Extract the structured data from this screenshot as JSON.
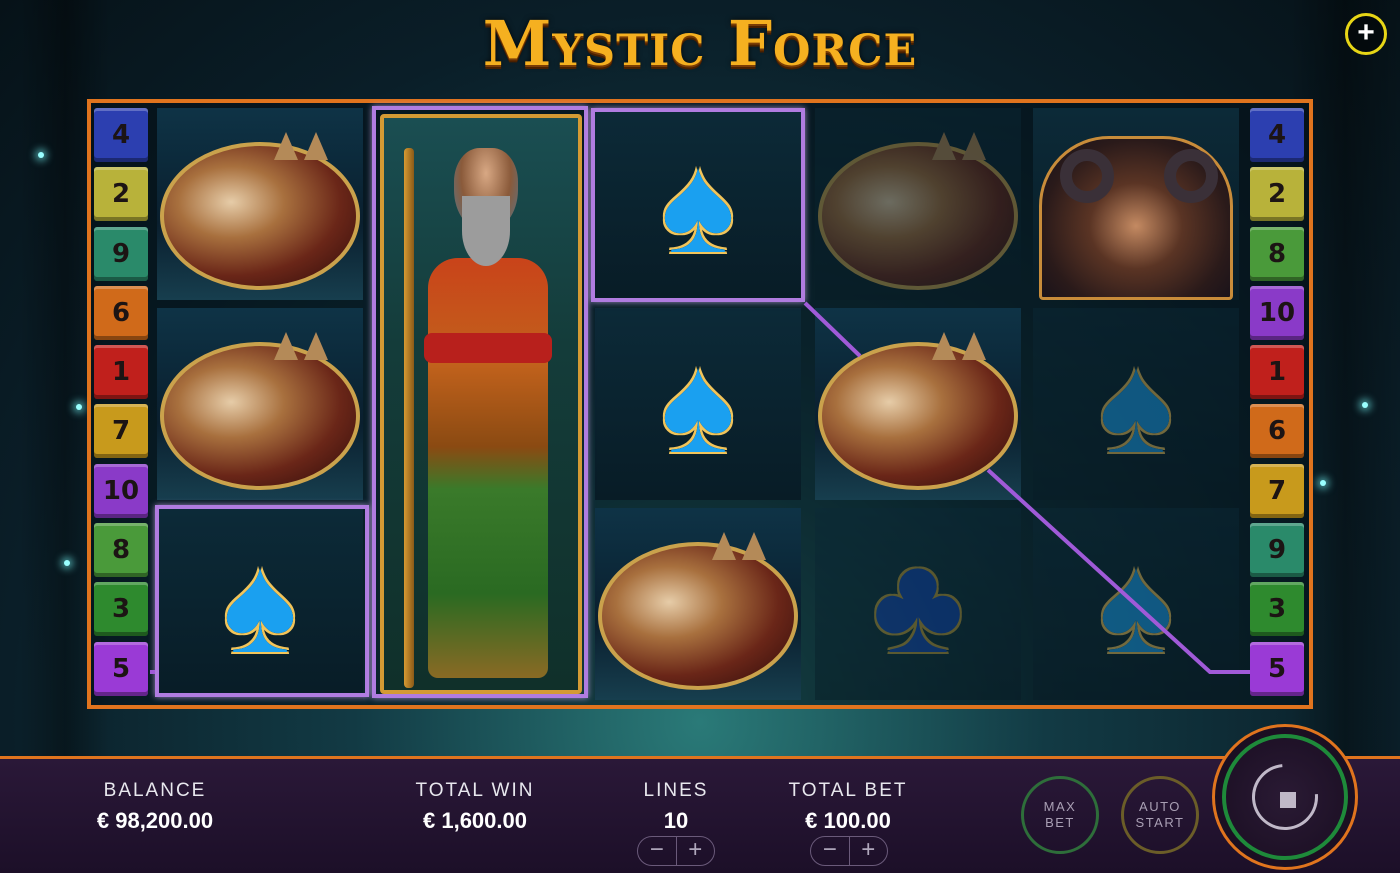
{
  "game": {
    "title": "Mystic Force"
  },
  "top": {
    "plus_symbol": "+"
  },
  "paylines": {
    "left": [
      "4",
      "2",
      "9",
      "6",
      "1",
      "7",
      "10",
      "8",
      "3",
      "5"
    ],
    "right": [
      "4",
      "2",
      "8",
      "10",
      "1",
      "6",
      "7",
      "9",
      "3",
      "5"
    ],
    "colors": {
      "1": "#c0201c",
      "2": "#b8b23a",
      "3": "#2e8a2e",
      "4": "#2c3fb0",
      "5": "#9a3ad6",
      "6": "#d06a1a",
      "7": "#c89a1c",
      "8": "#4a9a3a",
      "9": "#2a8a6a",
      "10": "#8a3ac8"
    }
  },
  "reels": [
    [
      "lynx",
      "lynx",
      "spade"
    ],
    [
      "wizard",
      "wizard",
      "wizard"
    ],
    [
      "spade",
      "spade",
      "lynx"
    ],
    [
      "lynx",
      "lynx",
      "club"
    ],
    [
      "beast",
      "spade",
      "spade"
    ]
  ],
  "symbols": {
    "spade": "♠",
    "club": "♣"
  },
  "bottom": {
    "balance_label": "BALANCE",
    "balance_value": "€ 98,200.00",
    "total_win_label": "TOTAL WIN",
    "total_win_value": "€ 1,600.00",
    "lines_label": "LINES",
    "lines_value": "10",
    "total_bet_label": "TOTAL BET",
    "total_bet_value": "€ 100.00",
    "minus": "−",
    "plus": "+",
    "max_bet": "MAX BET",
    "auto_start": "AUTO START"
  }
}
